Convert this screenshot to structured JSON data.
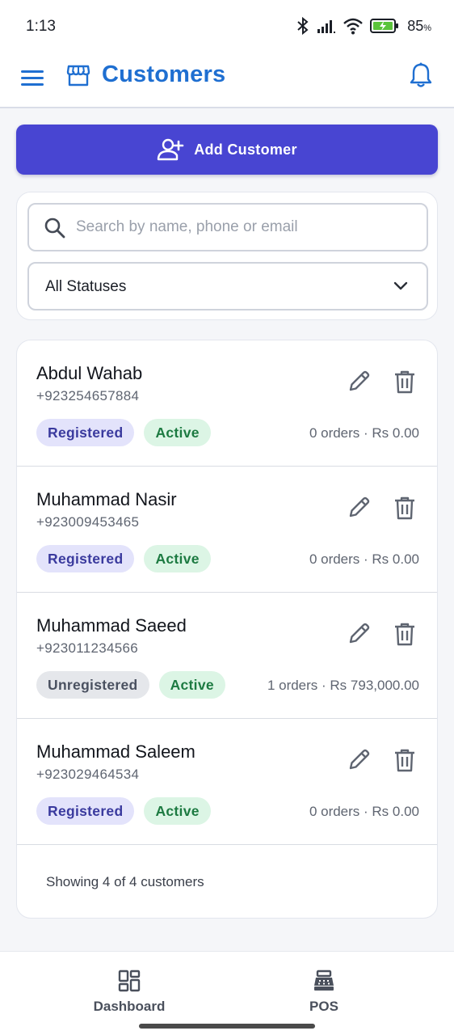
{
  "status_bar": {
    "time": "1:13",
    "battery_percent": "85",
    "battery_unit": "%"
  },
  "app_bar": {
    "title": "Customers",
    "title_color": "#1f6fd1"
  },
  "actions": {
    "add_customer_label": "Add Customer",
    "accent_color": "#4845d2"
  },
  "filters": {
    "search_placeholder": "Search by name, phone or email",
    "search_value": "",
    "status_selected": "All Statuses"
  },
  "customers": [
    {
      "name": "Abdul Wahab",
      "phone": "+923254657884",
      "registration": "Registered",
      "status": "Active",
      "summary": "0 orders · Rs 0.00"
    },
    {
      "name": "Muhammad Nasir",
      "phone": "+923009453465",
      "registration": "Registered",
      "status": "Active",
      "summary": "0 orders · Rs 0.00"
    },
    {
      "name": "Muhammad Saeed",
      "phone": "+923011234566",
      "registration": "Unregistered",
      "status": "Active",
      "summary": "1 orders · Rs 793,000.00"
    },
    {
      "name": "Muhammad Saleem",
      "phone": "+923029464534",
      "registration": "Registered",
      "status": "Active",
      "summary": "0 orders · Rs 0.00"
    }
  ],
  "list_footer": "Showing 4 of 4 customers",
  "bottom_nav": {
    "items": [
      {
        "label": "Dashboard",
        "icon": "dashboard-icon"
      },
      {
        "label": "POS",
        "icon": "cash-register-icon"
      }
    ]
  }
}
